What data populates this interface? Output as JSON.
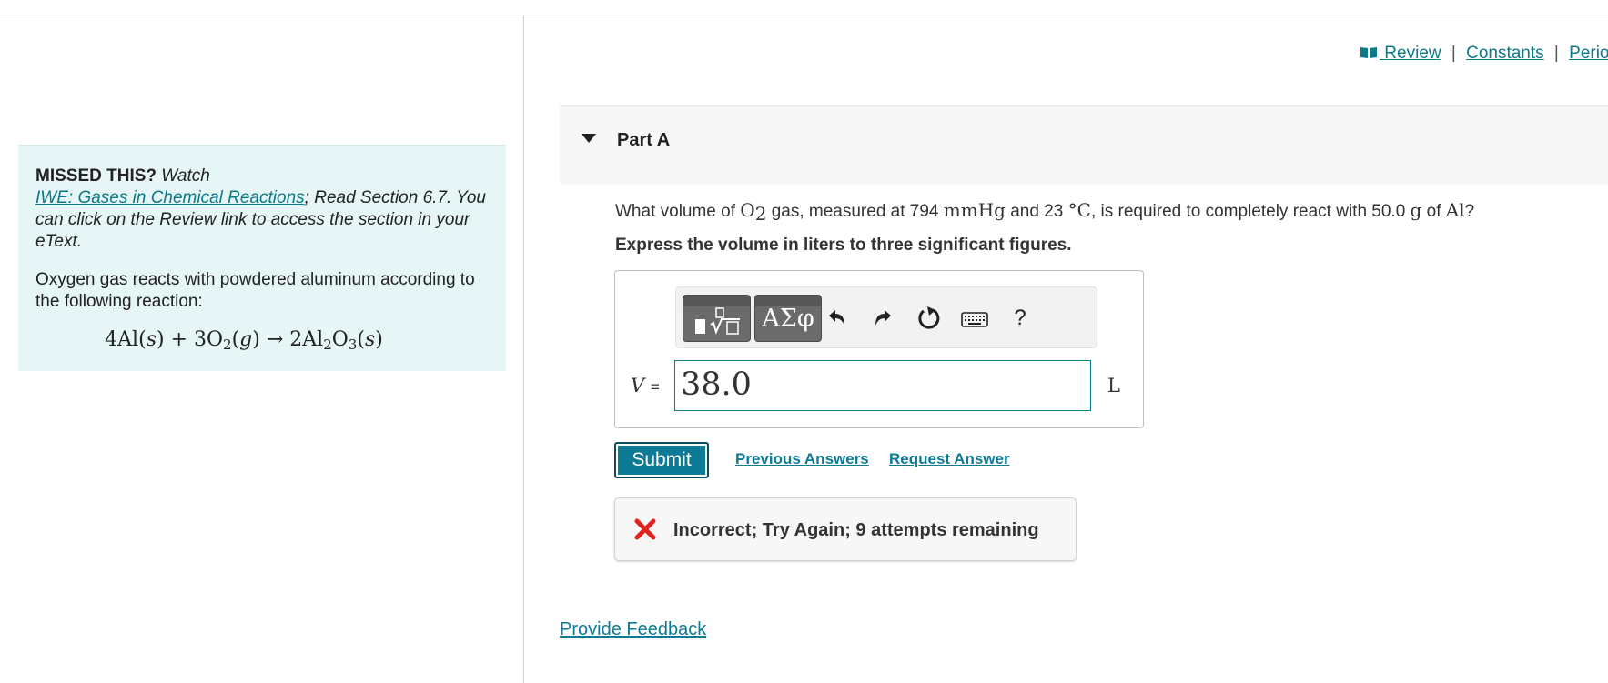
{
  "left_panel": {
    "missed_label": "MISSED THIS?",
    "watch_text": "Watch",
    "video_link": "IWE: Gases in Chemical Reactions",
    "read_text": "; Read Section 6.7. You can click on the Review link to access the section in your eText.",
    "body_text": "Oxygen gas reacts with powdered aluminum according to the following reaction:",
    "reaction": {
      "r1_coef": "4Al(",
      "r1_state": "s",
      "plus": ") + 3O",
      "o2_sub": "2",
      "r2_state_open": "(",
      "r2_state": "g",
      "arrow": ") → 2Al",
      "al_sub": "2",
      "o": "O",
      "o_sub": "3",
      "p_open": "(",
      "p_state": "s",
      "p_close": ")"
    }
  },
  "top_links": {
    "review": "Review",
    "constants": "Constants",
    "periodic": "Perio",
    "separator": "|"
  },
  "part": {
    "title": "Part A"
  },
  "question": {
    "q1": "What volume of ",
    "o2": "O",
    "o2_sub": "2",
    "q2": " gas, measured at 794 ",
    "pressure_unit": "mmHg",
    "q3": " and 23 ",
    "temp_unit": "°C",
    "q4": ", is required to completely react with 50.0 ",
    "mass_unit": "g",
    "q5": " of ",
    "element": "Al",
    "q6": "?",
    "instruction": "Express the volume in liters to three significant figures."
  },
  "answer": {
    "variable": "V",
    "equals": "=",
    "value": "38.0",
    "unit": "L",
    "toolbar": {
      "templates_icon": "sqrt-template-icon",
      "greek_label": "ΑΣφ",
      "undo_icon": "undo-icon",
      "redo_icon": "redo-icon",
      "reset_icon": "reset-icon",
      "keyboard_icon": "keyboard-icon",
      "help_label": "?"
    }
  },
  "actions": {
    "submit": "Submit",
    "previous_answers": "Previous Answers",
    "request_answer": "Request Answer"
  },
  "feedback": {
    "message": "Incorrect; Try Again; 9 attempts remaining",
    "icon": "x-icon",
    "icon_color": "#e0231f"
  },
  "footer": {
    "provide_feedback": "Provide Feedback"
  },
  "colors": {
    "accent": "#0d7a96",
    "hint_bg": "#e6f5f5"
  }
}
